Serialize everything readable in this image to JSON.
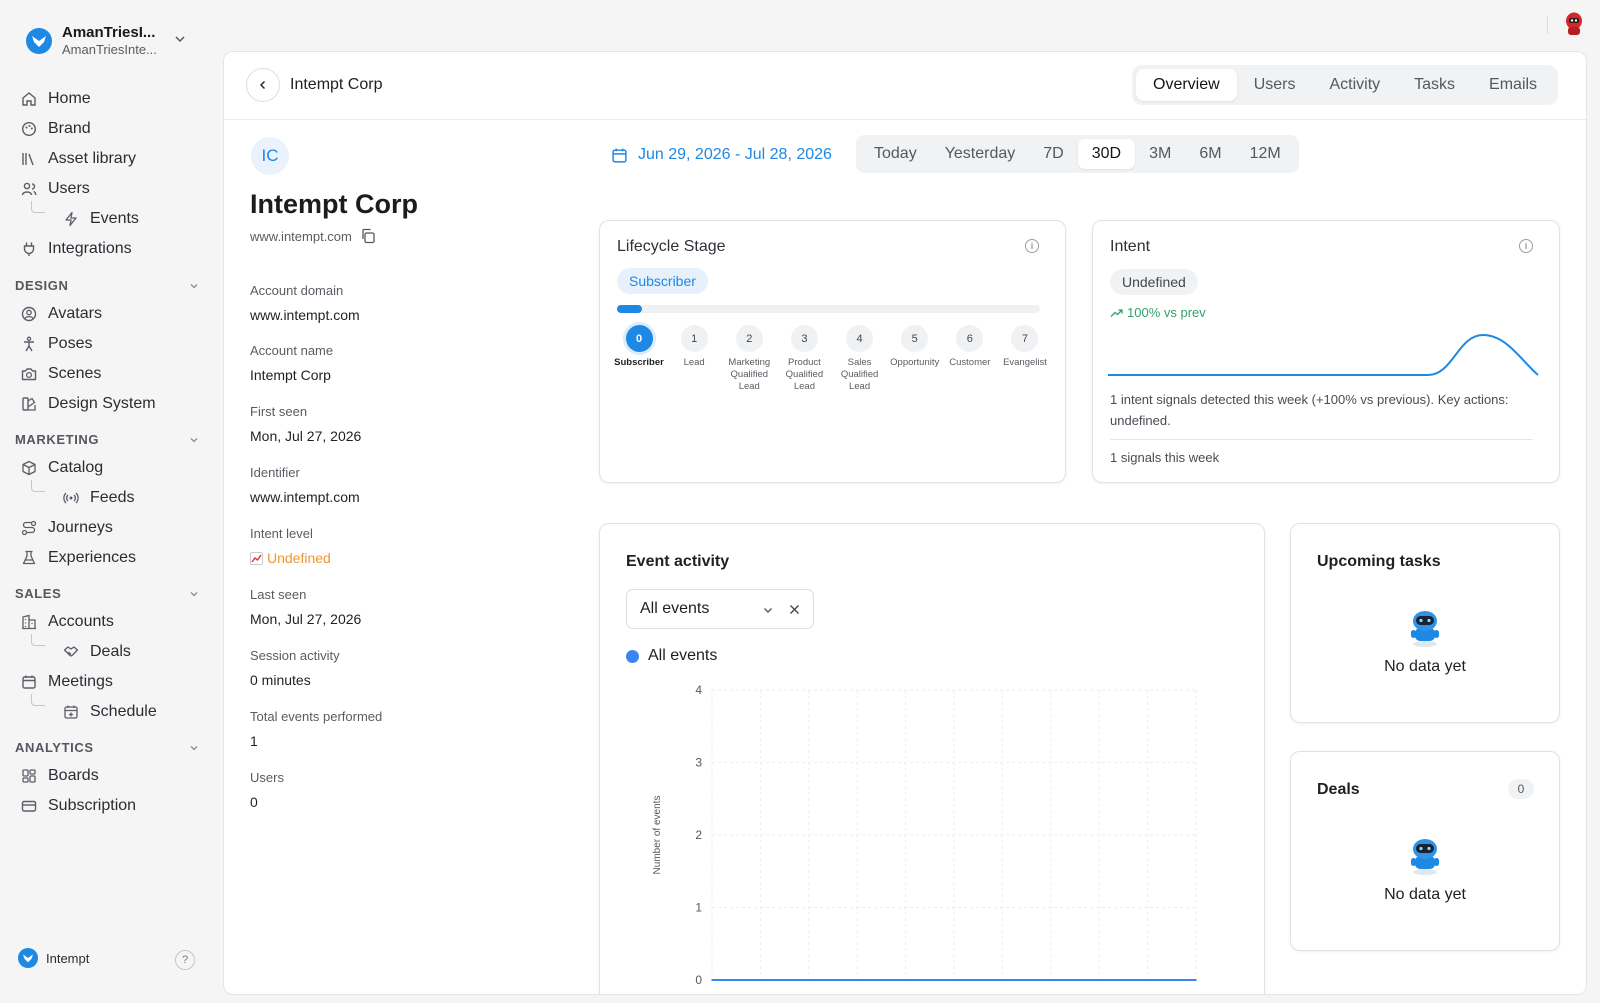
{
  "workspace": {
    "name": "AmanTriesI...",
    "subtitle": "AmanTriesInte..."
  },
  "nav": {
    "home": "Home",
    "brand": "Brand",
    "asset_library": "Asset library",
    "users": "Users",
    "events": "Events",
    "integrations": "Integrations",
    "design_section": "DESIGN",
    "avatars": "Avatars",
    "poses": "Poses",
    "scenes": "Scenes",
    "design_system": "Design System",
    "marketing_section": "MARKETING",
    "catalog": "Catalog",
    "feeds": "Feeds",
    "journeys": "Journeys",
    "experiences": "Experiences",
    "sales_section": "SALES",
    "accounts": "Accounts",
    "deals": "Deals",
    "meetings": "Meetings",
    "schedule": "Schedule",
    "analytics_section": "ANALYTICS",
    "boards": "Boards",
    "subscription": "Subscription"
  },
  "footer": {
    "brand": "Intempt",
    "help": "?"
  },
  "header": {
    "title": "Intempt Corp",
    "tabs": [
      "Overview",
      "Users",
      "Activity",
      "Tasks",
      "Emails"
    ],
    "active_tab": "Overview"
  },
  "account": {
    "initials": "IC",
    "name": "Intempt Corp",
    "website": "www.intempt.com",
    "fields": [
      {
        "label": "Account domain",
        "value": "www.intempt.com"
      },
      {
        "label": "Account name",
        "value": "Intempt Corp"
      },
      {
        "label": "First seen",
        "value": "Mon, Jul 27, 2026"
      },
      {
        "label": "Identifier",
        "value": "www.intempt.com"
      },
      {
        "label": "Intent level",
        "value": "Undefined"
      },
      {
        "label": "Last seen",
        "value": "Mon, Jul 27, 2026"
      },
      {
        "label": "Session activity",
        "value": "0 minutes"
      },
      {
        "label": "Total events performed",
        "value": "1"
      },
      {
        "label": "Users",
        "value": "0"
      }
    ]
  },
  "date_filter": {
    "range": "Jun 29, 2026 - Jul 28, 2026",
    "options": [
      "Today",
      "Yesterday",
      "7D",
      "30D",
      "3M",
      "6M",
      "12M"
    ],
    "active": "30D"
  },
  "lifecycle": {
    "title": "Lifecycle Stage",
    "current": "Subscriber",
    "progress_fraction": 0.06,
    "stages": [
      {
        "num": "0",
        "label": "Subscriber"
      },
      {
        "num": "1",
        "label": "Lead"
      },
      {
        "num": "2",
        "label": "Marketing Qualified Lead"
      },
      {
        "num": "3",
        "label": "Product Qualified Lead"
      },
      {
        "num": "4",
        "label": "Sales Qualified Lead"
      },
      {
        "num": "5",
        "label": "Opportunity"
      },
      {
        "num": "6",
        "label": "Customer"
      },
      {
        "num": "7",
        "label": "Evangelist"
      }
    ]
  },
  "intent": {
    "title": "Intent",
    "level": "Undefined",
    "trend": "100% vs prev",
    "description": "1 intent signals detected this week (+100% vs previous). Key actions: undefined.",
    "footer": "1 signals this week",
    "accent": "#1e88e5"
  },
  "event_activity": {
    "title": "Event activity",
    "filter_value": "All events",
    "legend": "All events"
  },
  "chart_data": {
    "type": "line",
    "series": [
      {
        "name": "All events",
        "values": [
          0,
          0,
          0,
          0,
          0,
          0,
          0,
          0,
          0,
          0,
          0,
          0,
          0,
          0,
          0,
          0,
          0,
          0,
          0,
          0,
          0,
          0,
          0,
          0,
          0,
          0,
          0,
          0,
          0,
          0
        ]
      }
    ],
    "ylabel": "Number of events",
    "xlabel": "",
    "yticks": [
      "4",
      "3",
      "2",
      "1",
      "0"
    ],
    "ylim": [
      0,
      4
    ],
    "grid": true,
    "color": "#3a86f0"
  },
  "upcoming_tasks": {
    "title": "Upcoming tasks",
    "empty": "No data yet"
  },
  "deals_card": {
    "title": "Deals",
    "count": "0",
    "empty": "No data yet"
  },
  "colors": {
    "accent": "#1e88e5",
    "success": "#33a06f",
    "warning": "#f0952f"
  }
}
